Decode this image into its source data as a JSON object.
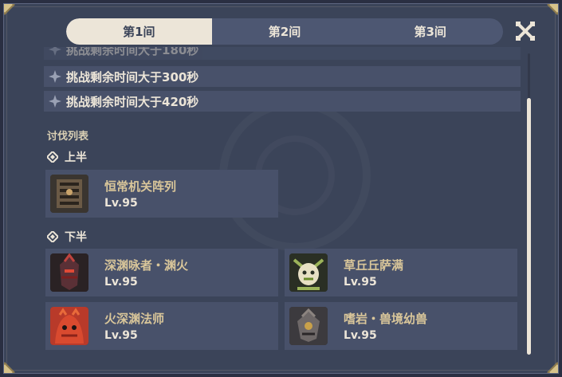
{
  "tabs": [
    {
      "label": "第1间",
      "active": true
    },
    {
      "label": "第2间",
      "active": false
    },
    {
      "label": "第3间",
      "active": false
    }
  ],
  "conditions": [
    {
      "text": "挑战剩余时间大于180秒",
      "faded": true
    },
    {
      "text": "挑战剩余时间大于300秒",
      "faded": false
    },
    {
      "text": "挑战剩余时间大于420秒",
      "faded": false
    }
  ],
  "enemy_list_title": "讨伐列表",
  "first_half": {
    "label": "上半",
    "enemies": [
      {
        "name": "恒常机关阵列",
        "level": "Lv.95",
        "portrait": "ruin-machine-portrait"
      }
    ]
  },
  "second_half": {
    "label": "下半",
    "enemies": [
      {
        "name": "深渊咏者・渊火",
        "level": "Lv.95",
        "portrait": "abyss-lector-portrait"
      },
      {
        "name": "草丘丘萨满",
        "level": "Lv.95",
        "portrait": "dendro-samachurl-portrait"
      },
      {
        "name": "火深渊法师",
        "level": "Lv.95",
        "portrait": "pyro-abyss-mage-portrait"
      },
      {
        "name": "嗜岩・兽境幼兽",
        "level": "Lv.95",
        "portrait": "rockfond-rifthound-whelp-portrait"
      }
    ]
  },
  "colors": {
    "panel": "#3b4459",
    "row": "#48516a",
    "tab_active": "#ece5d8",
    "enemy_name": "#d9c69a"
  }
}
